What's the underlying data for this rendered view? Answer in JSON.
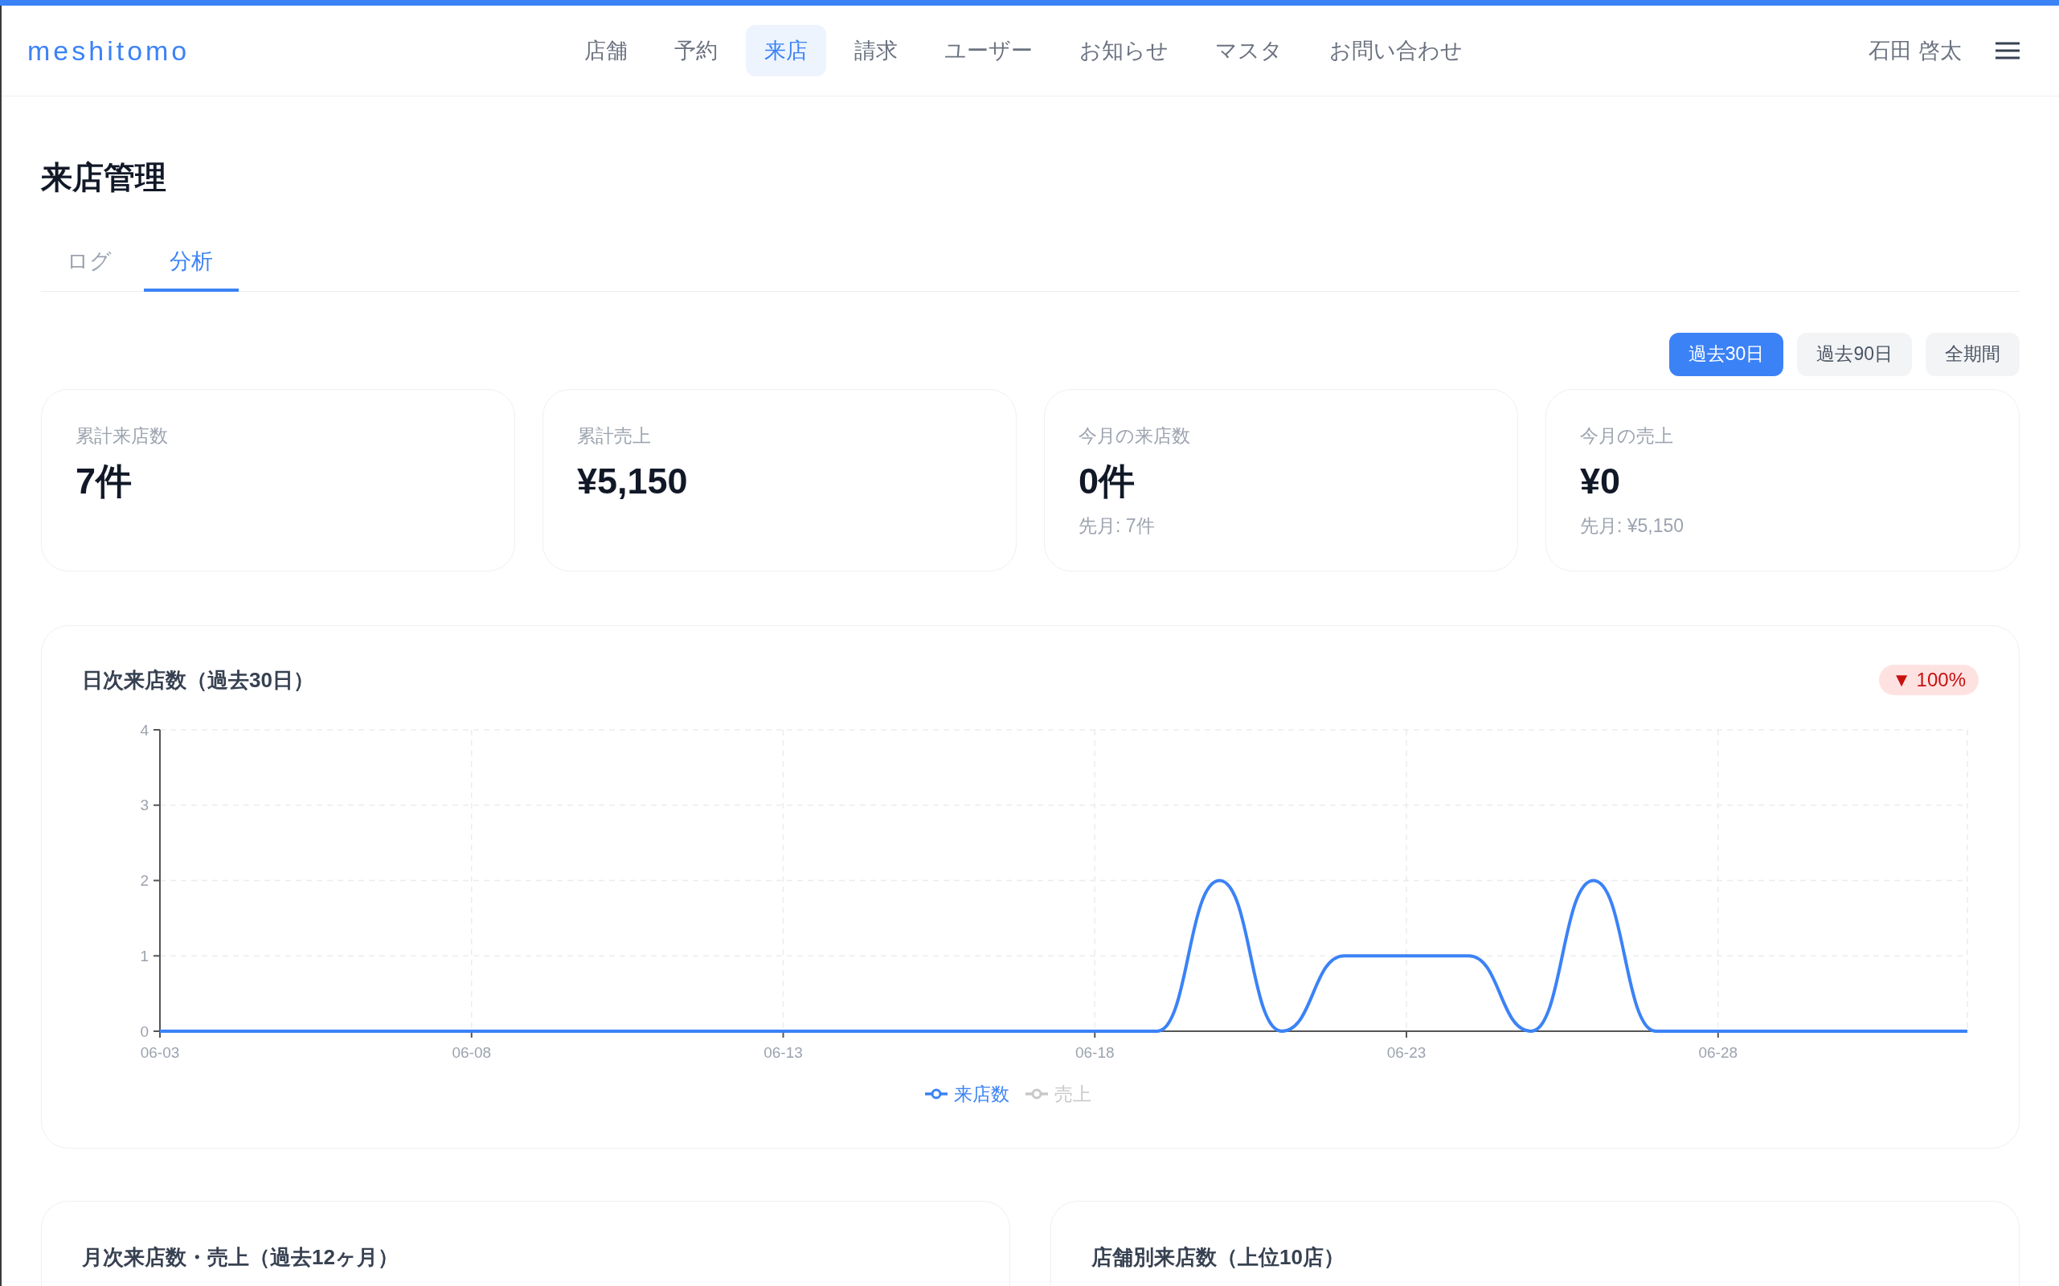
{
  "header": {
    "logo": "meshitomo",
    "nav": [
      {
        "label": "店舗",
        "selected": false
      },
      {
        "label": "予約",
        "selected": false
      },
      {
        "label": "来店",
        "selected": true
      },
      {
        "label": "請求",
        "selected": false
      },
      {
        "label": "ユーザー",
        "selected": false
      },
      {
        "label": "お知らせ",
        "selected": false
      },
      {
        "label": "マスタ",
        "selected": false
      },
      {
        "label": "お問い合わせ",
        "selected": false
      }
    ],
    "user_name": "石田 啓太"
  },
  "page": {
    "title": "来店管理"
  },
  "tabs": [
    {
      "label": "ログ",
      "selected": false
    },
    {
      "label": "分析",
      "selected": true
    }
  ],
  "period_filters": [
    {
      "label": "過去30日",
      "selected": true
    },
    {
      "label": "過去90日",
      "selected": false
    },
    {
      "label": "全期間",
      "selected": false
    }
  ],
  "stats": [
    {
      "label": "累計来店数",
      "value": "7件"
    },
    {
      "label": "累計売上",
      "value": "¥5,150"
    },
    {
      "label": "今月の来店数",
      "value": "0件",
      "sub": "先月: 7件"
    },
    {
      "label": "今月の売上",
      "value": "¥0",
      "sub": "先月: ¥5,150"
    }
  ],
  "daily_chart": {
    "title": "日次来店数（過去30日）",
    "change_badge": "▼ 100%",
    "chart_data": {
      "type": "line",
      "categories": [
        "06-03",
        null,
        null,
        null,
        null,
        "06-08",
        null,
        null,
        null,
        null,
        "06-13",
        null,
        null,
        null,
        null,
        "06-18",
        null,
        null,
        null,
        null,
        "06-23",
        null,
        null,
        null,
        null,
        "06-28",
        null,
        null,
        null,
        null
      ],
      "ylim": [
        0,
        4
      ],
      "yticks": [
        0,
        1,
        2,
        3,
        4
      ],
      "grid": true,
      "series": [
        {
          "name": "来店数",
          "color": "#3b82f6",
          "values": [
            0,
            0,
            0,
            0,
            0,
            0,
            0,
            0,
            0,
            0,
            0,
            0,
            0,
            0,
            0,
            0,
            0,
            2,
            0,
            1,
            1,
            1,
            0,
            2,
            0,
            0,
            0,
            0,
            0,
            0
          ]
        }
      ]
    },
    "legend": [
      {
        "selected": true
      },
      {
        "label": "売上",
        "selected": false
      }
    ]
  },
  "panels": [
    {
      "title": "月次来店数・売上（過去12ヶ月）"
    },
    {
      "title": "店舗別来店数（上位10店）"
    }
  ]
}
